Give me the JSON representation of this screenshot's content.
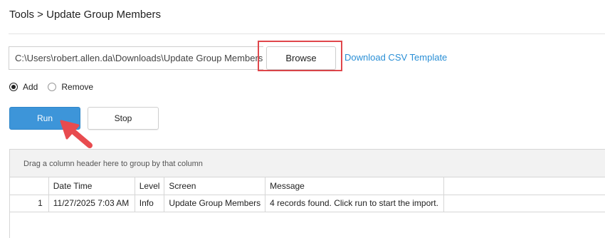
{
  "breadcrumb": "Tools > Update Group Members",
  "file_path": "C:\\Users\\robert.allen.da\\Downloads\\Update Group Members",
  "browse_label": "Browse",
  "csv_link": "Download CSV Template",
  "mode": {
    "options": [
      "Add",
      "Remove"
    ],
    "selected": "Add"
  },
  "run_label": "Run",
  "stop_label": "Stop",
  "grid": {
    "group_hint": "Drag a column header here to group by that column",
    "columns": [
      "",
      "Date Time",
      "Level",
      "Screen",
      "Message",
      ""
    ],
    "rows": [
      [
        "1",
        "11/27/2025 7:03 AM",
        "Info",
        "Update Group Members",
        "4 records found. Click run to start the import."
      ]
    ]
  },
  "colors": {
    "accent": "#3d95d9",
    "link": "#2a8fd6",
    "highlight": "#e0474c"
  }
}
